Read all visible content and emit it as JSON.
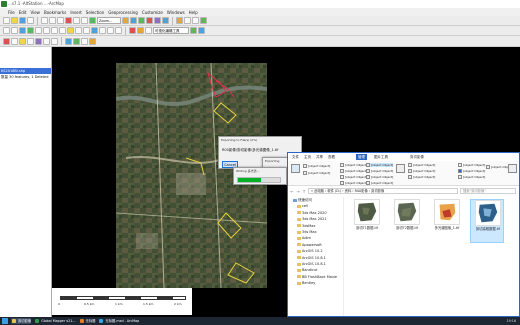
{
  "arcmap": {
    "title": "...s7.1 -AltStation ...-ArcMap",
    "menu": [
      "File",
      "Edit",
      "View",
      "Bookmarks",
      "Insert",
      "Selection",
      "Geoprocessing",
      "Customize",
      "Windows",
      "Help"
    ],
    "combo_label": "可视化编辑工具",
    "layer_combo": "Zoom...",
    "toc": {
      "selected": "KS2018Bi.shp",
      "rows": [
        "KS2018Bi.shp",
        "数量 30 features, 1 Deleted"
      ]
    },
    "scale": {
      "ticks": [
        "0",
        "0.5 km",
        "1 km",
        "1.5 km",
        "2 km"
      ]
    }
  },
  "export_dialog": {
    "caption": "Exporting to File(s) (0%)",
    "line1": "R00影像\\剪切影像\\多光谱图像_1.tif",
    "ok": "Cancel"
  },
  "export_dialog2": {
    "caption": "Exporting",
    "line": "Writing 多光谱...",
    "progress": 0.55,
    "btn_cancel": "Cancel"
  },
  "explorer": {
    "tabs": [
      "文件",
      "主页",
      "共享",
      "查看",
      "图片工具"
    ],
    "active_tab": "管理",
    "window_title": "剪切影像",
    "ribbon": {
      "pane_group": "窗格",
      "layout_group": "布局",
      "view_group": "当前视图",
      "show_group": "显示/隐藏",
      "items": [
        {
          "label": "预览窗格"
        },
        {
          "label": "详细信息窗格"
        },
        {
          "label": "超大图标"
        },
        {
          "label": "大图标"
        },
        {
          "label": "中图标"
        },
        {
          "label": "小图标"
        },
        {
          "label": "列表"
        },
        {
          "label": "详细信息"
        },
        {
          "label": "平铺"
        },
        {
          "label": "内容"
        },
        {
          "label": "分组依据"
        },
        {
          "label": "添加列"
        },
        {
          "label": "将所有列调整为合适的大小"
        },
        {
          "label": "项目复选框"
        },
        {
          "label": "文件扩展名"
        },
        {
          "label": "隐藏的项目"
        },
        {
          "label": "隐藏所选项目"
        },
        {
          "label": "选项"
        }
      ]
    },
    "address": "« 此电脑 › 软件 (D:) › 资料 › R00影像 › 剪切影像",
    "search_placeholder": "搜索\"剪切影像\"",
    "nav_items": [
      "快速访问",
      "cell",
      "3ds Max 2020",
      "3ds Max 2021",
      "3dsMax",
      "3ds Max",
      "Adlm",
      "Apowersoft",
      "ArcGIS 10.2",
      "ArcGIS 10.8.1",
      "ArcGIS 10.8.1",
      "Bandicut",
      "BB FlashBack Movie",
      "Bentley"
    ],
    "files": [
      {
        "name": "剪切T1数据.tif"
      },
      {
        "name": "剪切T2数据.tif"
      },
      {
        "name": "多光谱图像_1.tif"
      },
      {
        "name": "剪切高程数据.tif"
      }
    ],
    "status": [
      "4个项目",
      "选中1个项目 4.00 MB"
    ]
  },
  "taskbar": {
    "items": [
      "剪切影像",
      "Global Mapper v21...",
      "无标题",
      "无标题.mxd - ArcMap"
    ],
    "clock": "19:16"
  },
  "colors": {
    "accent": "#2b66c4",
    "progress": "#06b025",
    "selection": "#3a6fd8"
  }
}
